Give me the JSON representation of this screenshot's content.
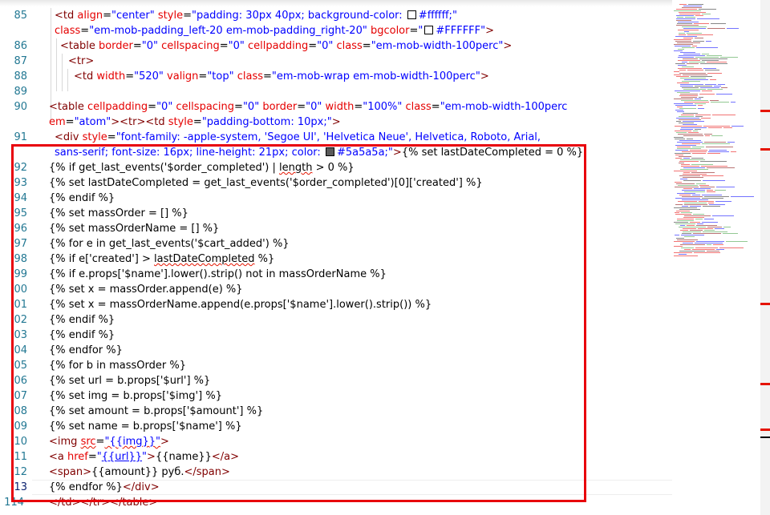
{
  "editor": {
    "swatches": {
      "white": "#ffffff",
      "gray": "#5a5a5a"
    },
    "colors": {
      "line_number": "#237893",
      "tag": "#800000",
      "attribute": "#e50000",
      "value": "#0000ff",
      "highlight_box": "#e8000b",
      "squiggle": "#e51400"
    },
    "lines": {
      "l85": {
        "num": "85",
        "t1": "<td ",
        "a1": "align",
        "p1": "=",
        "v1": "\"center\"",
        "a2": " style",
        "p2": "=",
        "v2": "\"padding: 30px 40px; background-color: ",
        "v3": "#ffffff;\""
      },
      "l85b": {
        "a1": "class",
        "p1": "=",
        "v1": "\"em-mob-padding_left-20 em-mob-padding_right-20\"",
        "a2": " bgcolor",
        "p2": "=",
        "v2": "\"",
        "v3": "#FFFFFF\"",
        "t2": ">"
      },
      "l86": {
        "num": "86",
        "t1": "<table ",
        "a1": "border",
        "p1": "=",
        "v1": "\"0\"",
        "a2": " cellspacing",
        "p2": "=",
        "v2": "\"0\"",
        "a3": " cellpadding",
        "p3": "=",
        "v3": "\"0\"",
        "a4": " class",
        "p4": "=",
        "v4": "\"em-mob-width-100perc\"",
        "t2": ">"
      },
      "l87": {
        "num": "87",
        "t1": "<tr>"
      },
      "l88": {
        "num": "88",
        "t1": "<td ",
        "a1": "width",
        "p1": "=",
        "v1": "\"520\"",
        "a2": " valign",
        "p2": "=",
        "v2": "\"top\"",
        "a3": " class",
        "p3": "=",
        "v3": "\"em-mob-wrap em-mob-width-100perc\"",
        "t2": ">"
      },
      "l89": {
        "num": "89"
      },
      "l90": {
        "num": "90",
        "t1": "<table ",
        "a1": "cellpadding",
        "p1": "=",
        "v1": "\"0\"",
        "a2": " cellspacing",
        "p2": "=",
        "v2": "\"0\"",
        "a3": " border",
        "p3": "=",
        "v3": "\"0\"",
        "a4": " width",
        "p4": "=",
        "v4": "\"100%\"",
        "a5": " class",
        "p5": "=",
        "v5": "\"em-mob-width-100perc"
      },
      "l90b": {
        "a1": "em",
        "p1": "=",
        "v1": "\"atom\"",
        "t1": "><tr><td ",
        "a2": "style",
        "p2": "=",
        "v2": "\"padding-bottom: 10px;\"",
        "t2": ">"
      },
      "l91": {
        "num": "91",
        "t1": "<div ",
        "a1": "style",
        "p1": "=",
        "v1": "\"font-family: -apple-system, 'Segoe UI', 'Helvetica Neue', Helvetica, Roboto, Arial,"
      },
      "l91b": {
        "v1": "sans-serif; font-size: 16px; line-height: 21px; color: ",
        "v2": "#5a5a5a;\"",
        "t1": ">",
        "p1": "{% set lastDateCompleted = 0 %}"
      },
      "l92": {
        "num": "92",
        "p1": "{% if get_last_events('$order_completed') | ",
        "sq": "length",
        "p2": " > 0 %}"
      },
      "l93": {
        "num": "93",
        "p1": "{% set lastDateCompleted = get_last_events('$order_completed')[0]['created'] %}"
      },
      "l94": {
        "num": "94",
        "p1": "{% endif %}"
      },
      "l95": {
        "num": "95",
        "p1": "{% set massOrder = [] %}"
      },
      "l96": {
        "num": "96",
        "p1": "{% set massOrderName = [] %}"
      },
      "l97": {
        "num": "97",
        "p1": "{% for e in get_last_events('$cart_added') %}"
      },
      "l98": {
        "num": "98",
        "p1": "{% if e['created'] > ",
        "sq": "lastDateCompleted",
        "p2": " %}"
      },
      "l99": {
        "num": "99",
        "p1": "{% if e.props['$name'].lower().strip() not in massOrderName %}"
      },
      "l100": {
        "num": "00",
        "p1": "{% set x = massOrder.append(e) %}"
      },
      "l101": {
        "num": "01",
        "p1": "{% set x = massOrderName.append(e.props['$name'].lower().strip()) %}"
      },
      "l102": {
        "num": "02",
        "p1": "{% endif %}"
      },
      "l103": {
        "num": "03",
        "p1": "{% endif %}"
      },
      "l104": {
        "num": "04",
        "p1": "{% endfor %}"
      },
      "l105": {
        "num": "05",
        "p1": "{% for b in massOrder %}"
      },
      "l106": {
        "num": "06",
        "p1": "{% set url = b.props['$url'] %}"
      },
      "l107": {
        "num": "07",
        "p1": "{% set img = b.props['$img'] %}"
      },
      "l108": {
        "num": "08",
        "p1": "{% set amount = b.props['$amount'] %}"
      },
      "l109": {
        "num": "09",
        "p1": "{% set name = b.props['$name'] %}"
      },
      "l110": {
        "num": "10",
        "t1": "<img ",
        "a1": "src",
        "p1": "=",
        "v1": "\"{{img}}\"",
        "t2": ">"
      },
      "l111": {
        "num": "11",
        "t1": "<a ",
        "a1": "href",
        "p1": "=",
        "v1q": "\"",
        "v1": "{{url}}",
        "v1e": "\"",
        "t2": ">",
        "p2": "{{name}}",
        "t3": "</a>"
      },
      "l112": {
        "num": "12",
        "t1": "<span>",
        "p1": "{{amount}} руб.",
        "t2": "</span>"
      },
      "l113": {
        "num": "13",
        "p1": "{% endfor %}",
        "t1": "</div>"
      },
      "l114": {
        "num": "114",
        "t1": "</td></tr></table>"
      }
    }
  }
}
